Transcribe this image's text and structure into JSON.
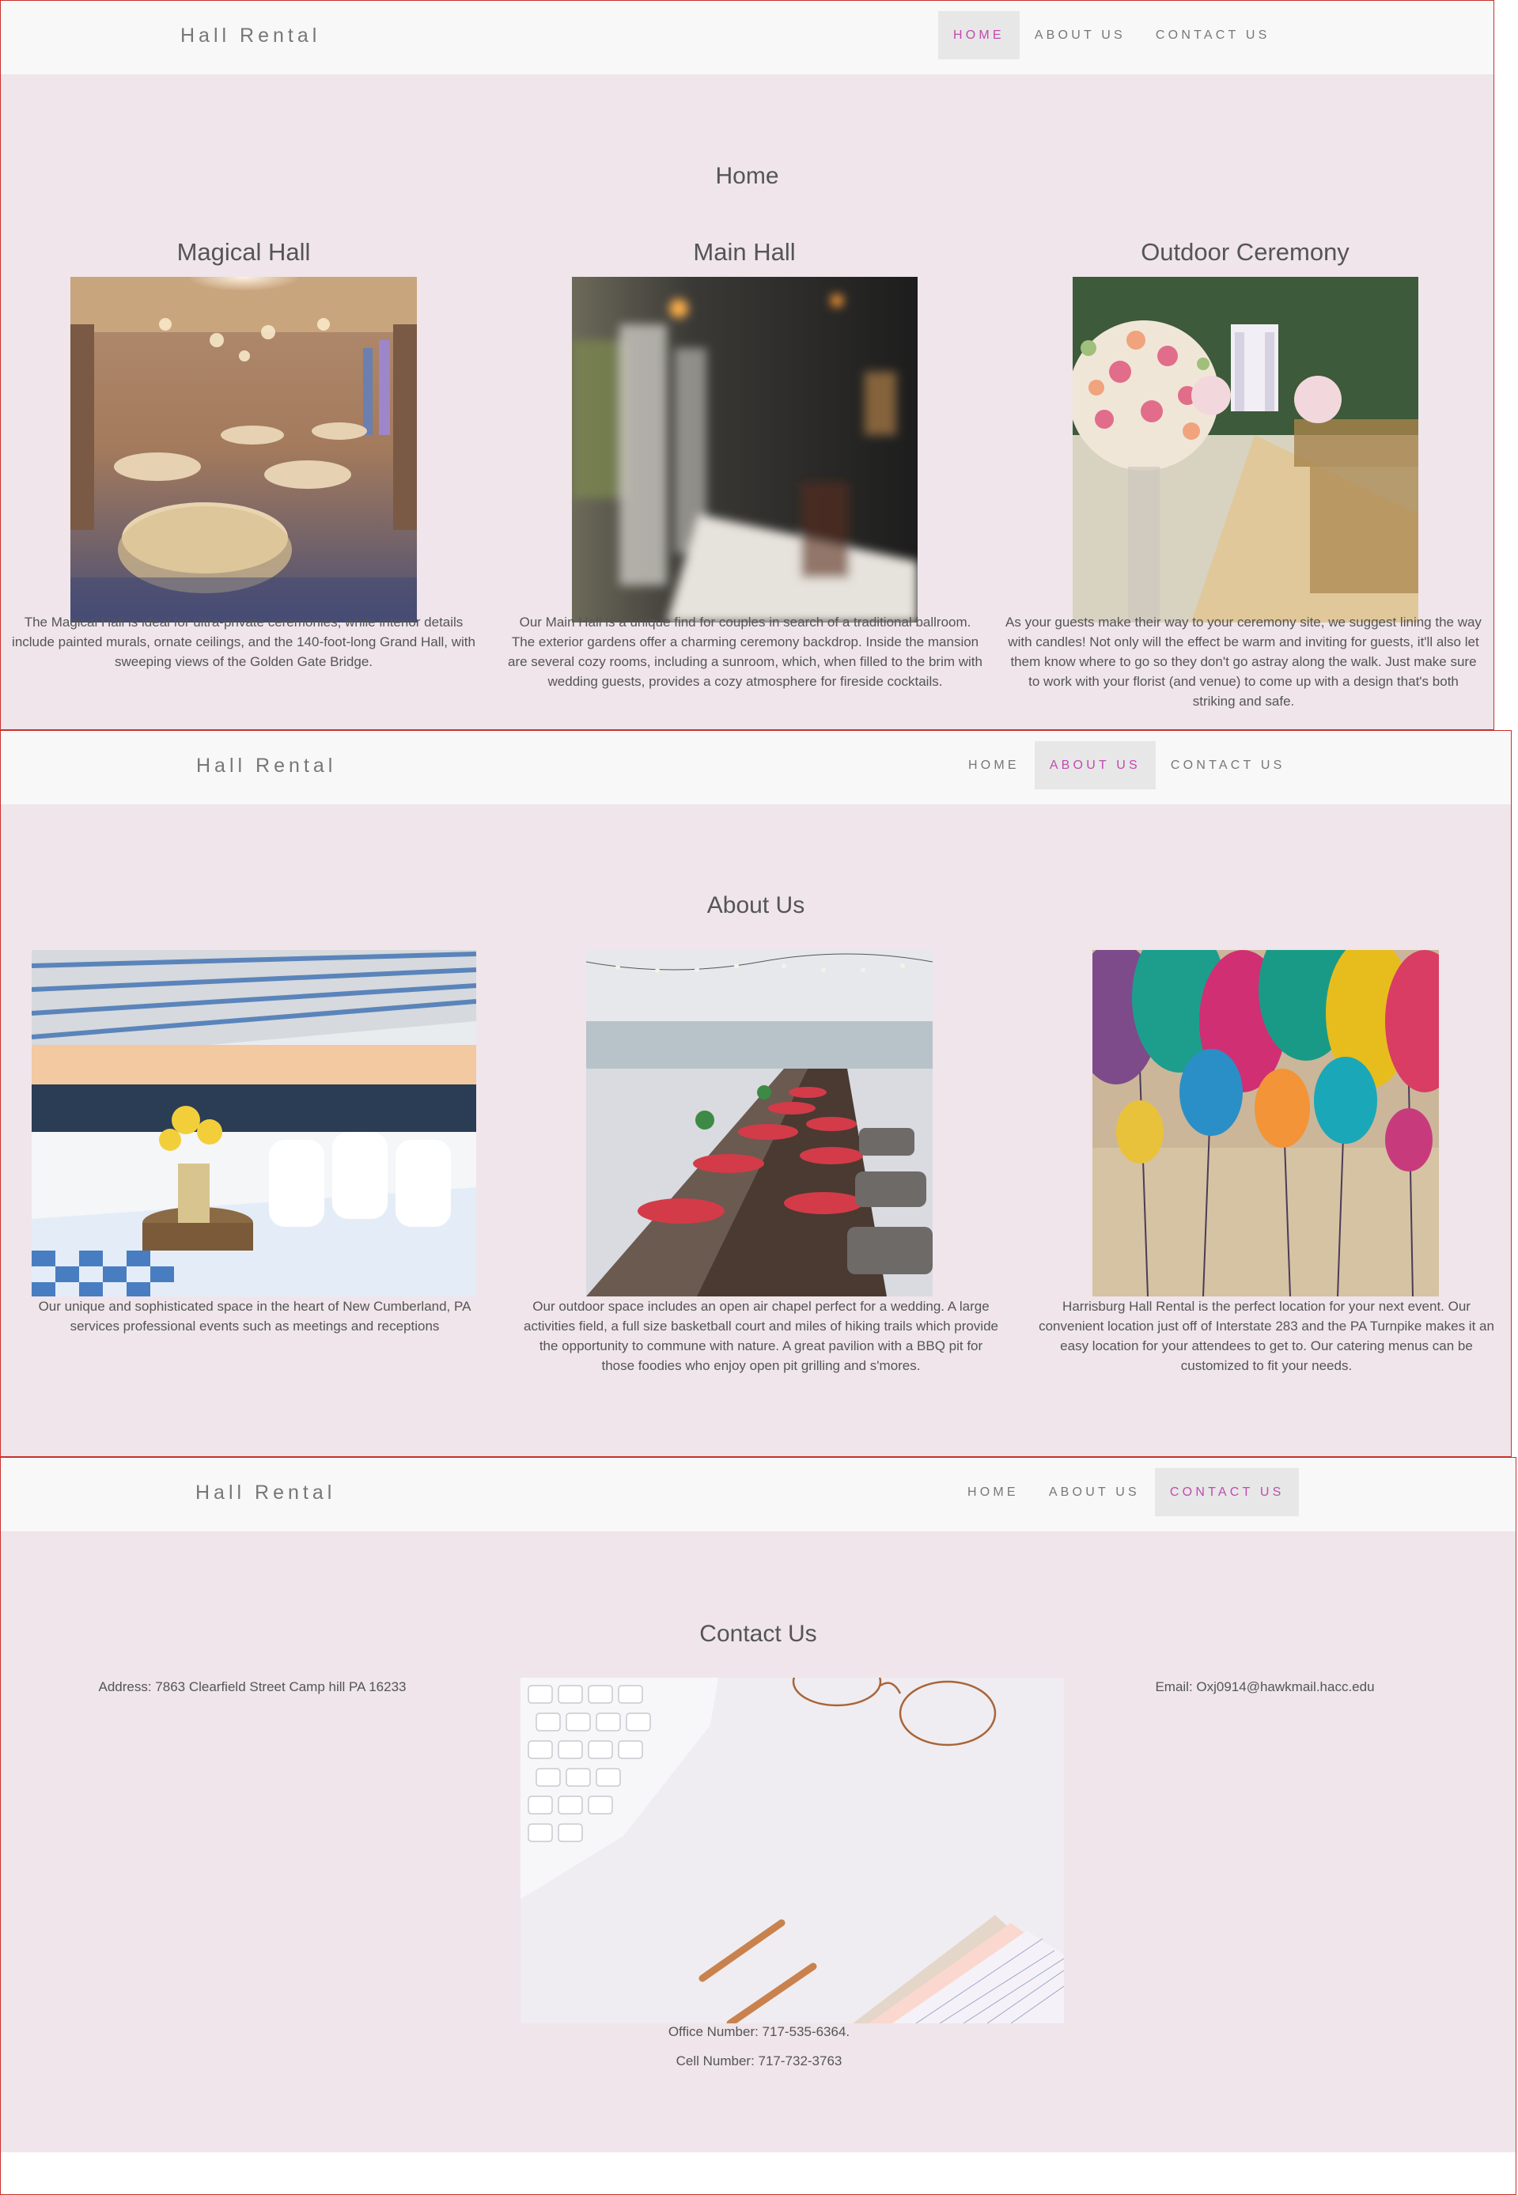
{
  "brand": "Hall Rental",
  "nav": {
    "home": "HOME",
    "about": "ABOUT US",
    "contact": "CONTACT US"
  },
  "home": {
    "title": "Home",
    "halls": [
      {
        "name": "Magical Hall",
        "description": "The Magical Hall is ideal for ultra-private ceremonies, while interior details include painted murals, ornate ceilings, and the 140-foot-long Grand Hall, with sweeping views of the Golden Gate Bridge."
      },
      {
        "name": "Main Hall",
        "description": "Our Main Hall is a unique find for couples in search of a traditional ballroom. The exterior gardens offer a charming ceremony backdrop. Inside the mansion are several cozy rooms, including a sunroom, which, when filled to the brim with wedding guests, provides a cozy atmosphere for fireside cocktails."
      },
      {
        "name": "Outdoor Ceremony",
        "description": "As your guests make their way to your ceremony site, we suggest lining the way with candles! Not only will the effect be warm and inviting for guests, it'll also let them know where to go so they don't go astray along the walk. Just make sure to work with your florist (and venue) to come up with a design that's both striking and safe."
      }
    ]
  },
  "about": {
    "title": "About Us",
    "items": [
      {
        "description": "Our unique and sophisticated space in the heart of New Cumberland, PA services professional events such as meetings and receptions"
      },
      {
        "description": "Our outdoor space includes an open air chapel perfect for a wedding. A large activities field, a full size basketball court and miles of hiking trails which provide the opportunity to commune with nature. A great pavilion with a BBQ pit for those foodies who enjoy open pit grilling and s'mores."
      },
      {
        "description": "Harrisburg Hall Rental is the perfect location for your next event. Our convenient location just off of Interstate 283 and the PA Turnpike makes it an easy location for your attendees to get to. Our catering menus can be customized to fit your needs."
      }
    ]
  },
  "contact": {
    "title": "Contact Us",
    "address": "Address: 7863 Clearfield Street Camp hill PA 16233",
    "email": "Email: Oxj0914@hawkmail.hacc.edu",
    "office": "Office Number: 717-535-6364.",
    "cell": "Cell Number: 717-732-3763"
  },
  "colors": {
    "accent": "#c24ab0",
    "background": "#efe5ea",
    "navbar": "#f8f8f8",
    "active_tab": "#e7e7e7",
    "frame_border": "#c9302c"
  }
}
